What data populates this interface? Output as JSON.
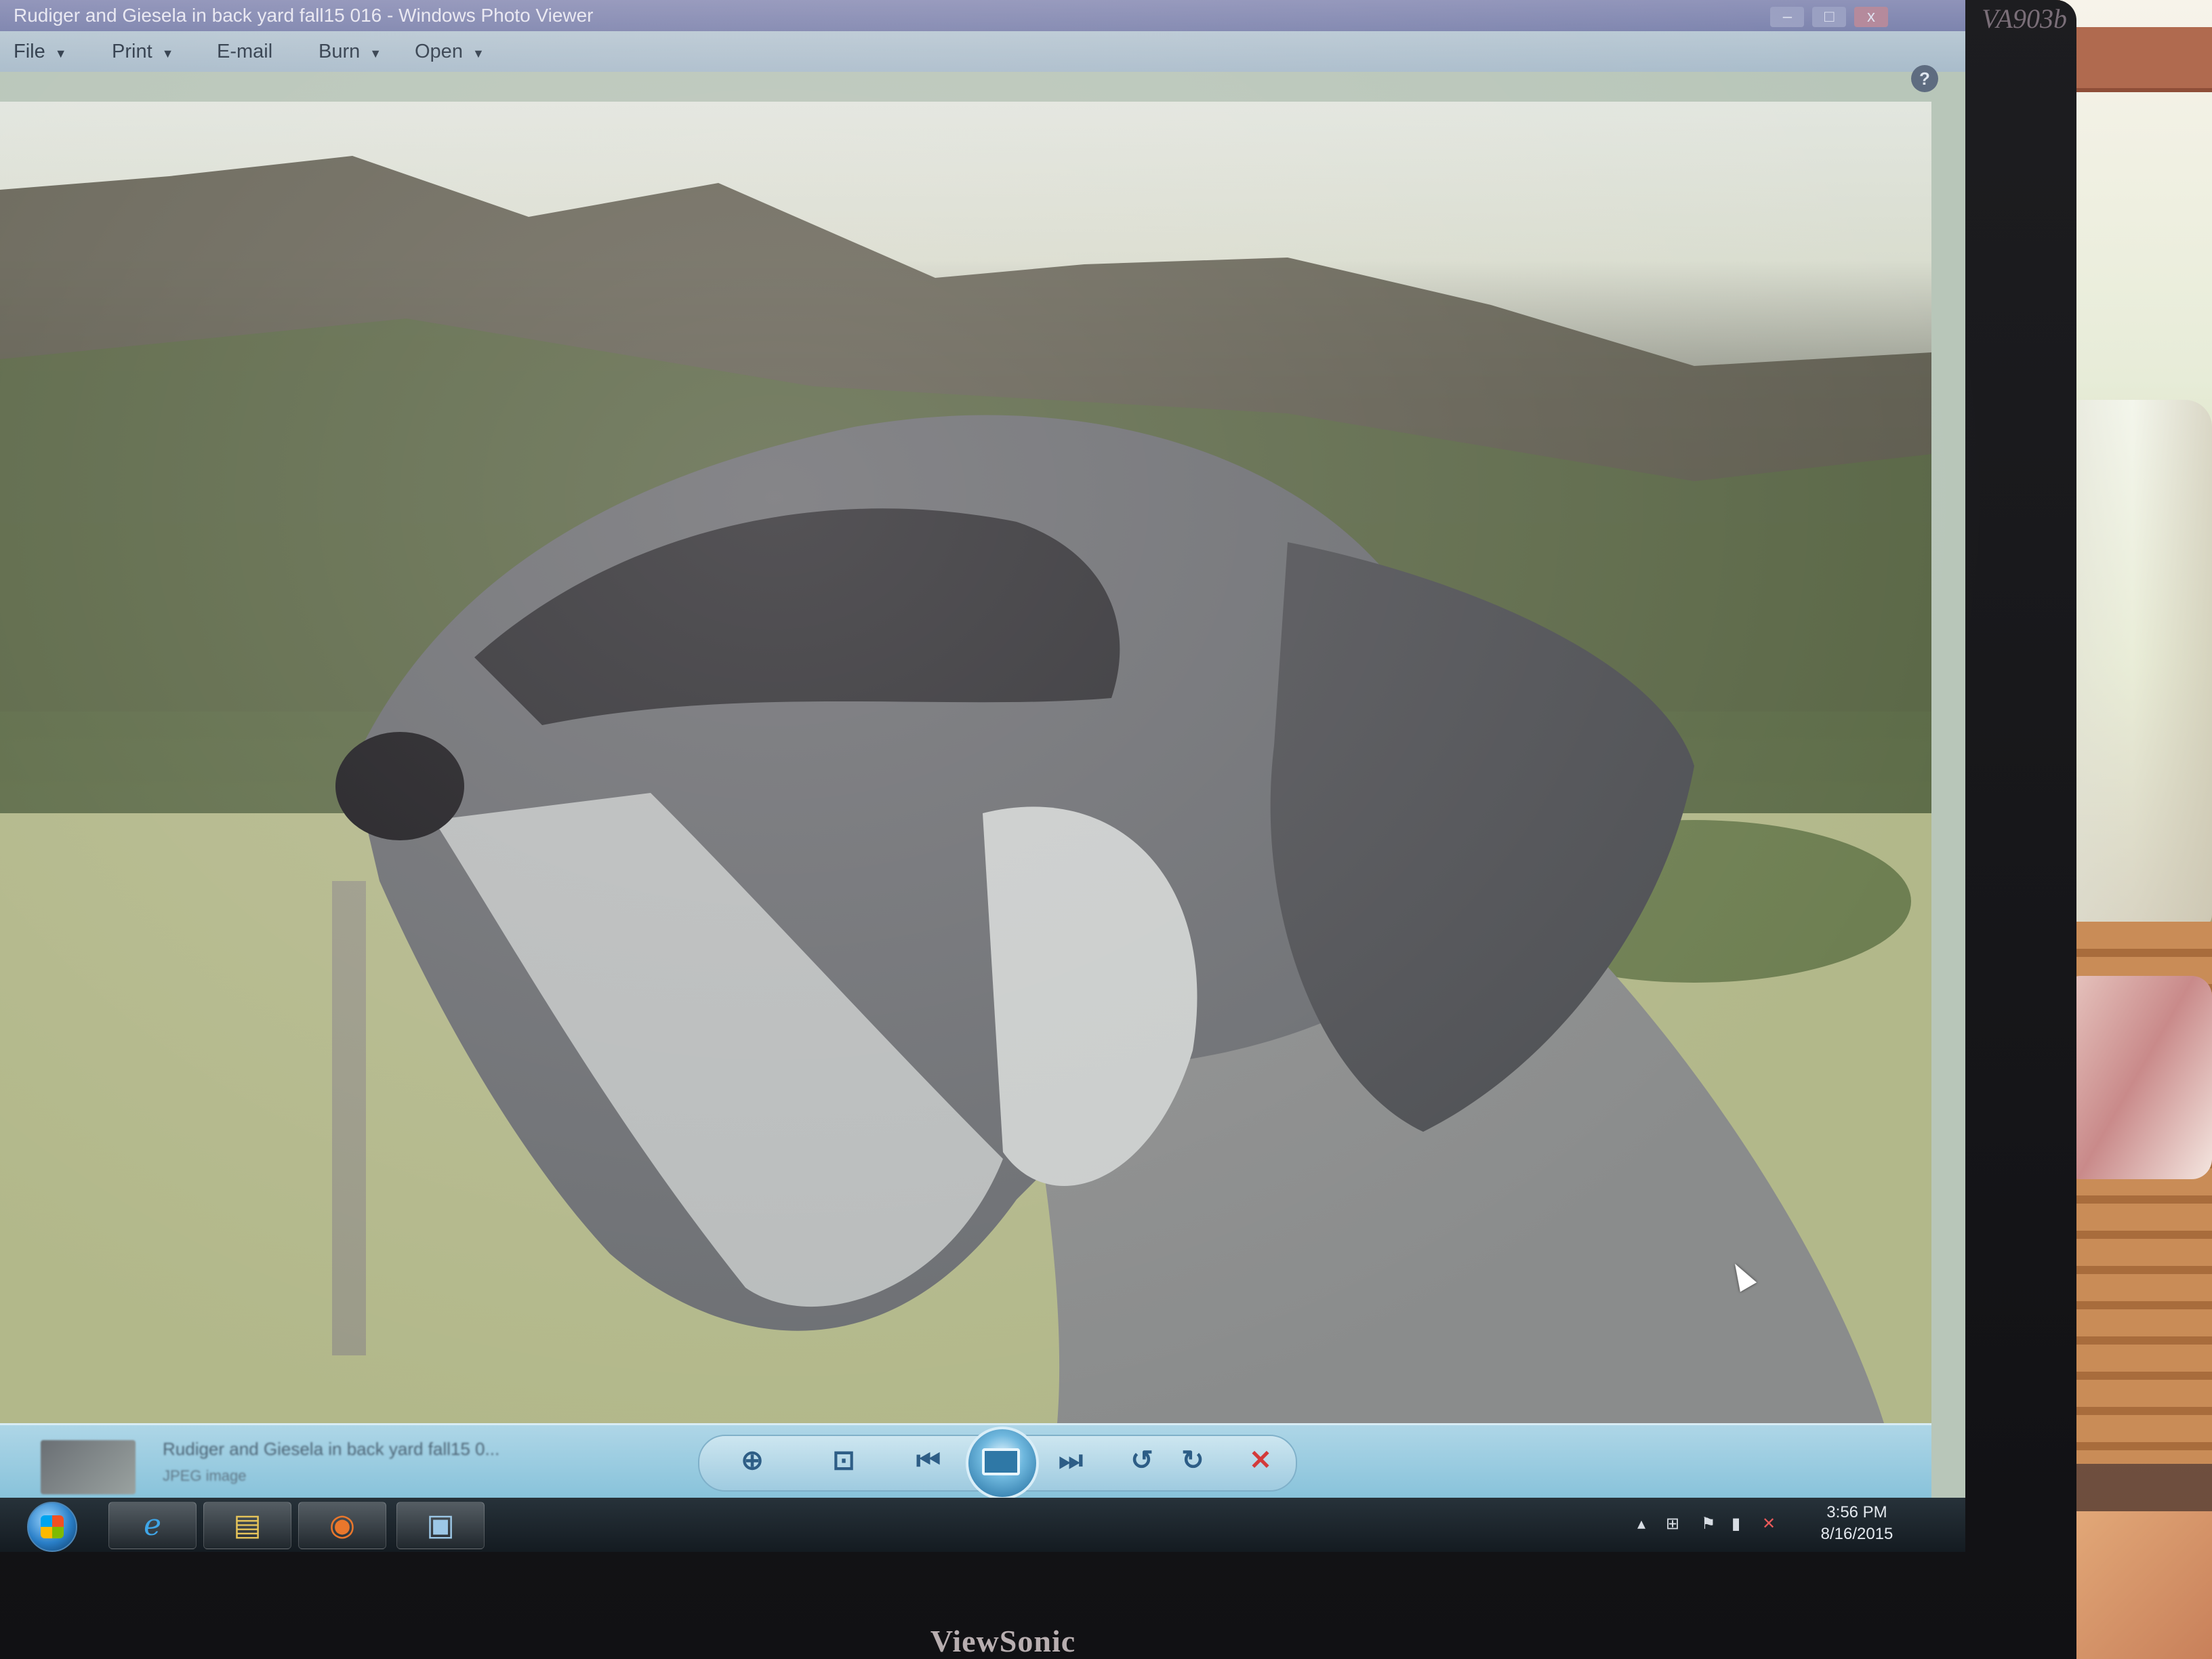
{
  "window": {
    "title": "Rudiger and Giesela in back yard fall15 016 - Windows Photo Viewer",
    "controls": [
      "–",
      "□",
      "x"
    ]
  },
  "monitor": {
    "brand": "ViewSonic",
    "model": "VA903b"
  },
  "menu": {
    "items": [
      {
        "label": "File",
        "has_arrow": true
      },
      {
        "label": "Print",
        "has_arrow": true
      },
      {
        "label": "E-mail",
        "has_arrow": false
      },
      {
        "label": "Burn",
        "has_arrow": true
      },
      {
        "label": "Open",
        "has_arrow": true
      }
    ],
    "arrow_glyph": "▼",
    "help_glyph": "?"
  },
  "photo": {
    "subject": "schnauzer dog profile",
    "background": "mountains and field"
  },
  "viewer_bar": {
    "file_name": "Rudiger and Giesela in back yard fall15 0...",
    "file_type": "JPEG image",
    "controls": {
      "zoom": "⊕",
      "fit": "⊡",
      "previous": "⏮",
      "next": "⏭",
      "rotate_ccw": "↺",
      "rotate_cw": "↻",
      "delete": "✕"
    }
  },
  "taskbar": {
    "apps": [
      {
        "name": "internet-explorer",
        "glyph": "e"
      },
      {
        "name": "file-explorer",
        "glyph": "▤"
      },
      {
        "name": "firefox",
        "glyph": "◉"
      },
      {
        "name": "photo-viewer",
        "glyph": "▣"
      }
    ],
    "tray": {
      "clock_time": "3:56 PM",
      "clock_date": "8/16/2015"
    }
  },
  "colors": {
    "taskbar": "#141b21",
    "viewer_bar": "#87c2da",
    "titlebar": "#7d84ae",
    "delete_icon": "#d33a3a"
  }
}
